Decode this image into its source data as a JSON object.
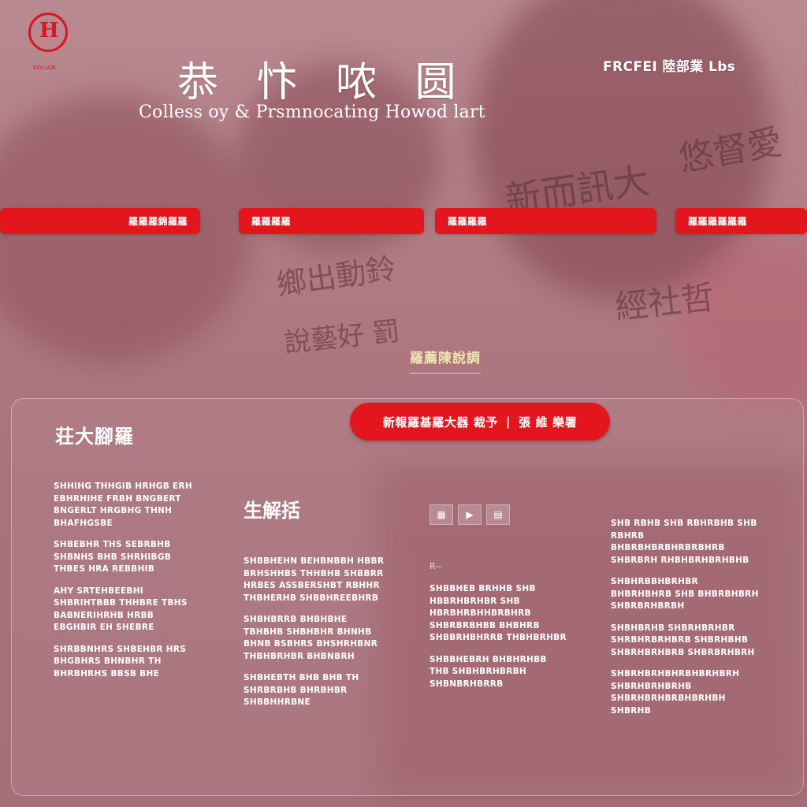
{
  "header": {
    "logo_caption": "KOLIAN",
    "logo_mark": "H",
    "title_cn": "恭 忭 哝 圆",
    "title_en": "Colless oy & Prsmnocating Howod lart",
    "top_right": "FRCFEI 陸部業 Lbs"
  },
  "background_script": [
    "新而訊大",
    "悠督愛",
    "經社哲",
    "鄉出動鈴",
    "說藝好 罰"
  ],
  "nav": [
    {
      "label": "羅羅羅錦羅羅"
    },
    {
      "label": "羅羅羅羅"
    },
    {
      "label": "羅羅羅羅"
    },
    {
      "label": "羅羅羅羅羅羅"
    }
  ],
  "center_label": "羅薦陳說調",
  "cta": {
    "left": "新報羅基羅大器 裁予",
    "right": "張 維 樂署"
  },
  "section_title": "荘大腳羅",
  "column_title": "生解括",
  "media_label": "R--",
  "columns": {
    "c1": [
      "SHHIHG THHGIB HRHGB ERH EBHRHIHE FRBH BNGBERT BNGERLT HRGBHG THNH BHAFHGSBE",
      "SHBEBHR THS SEBRBHB SHBNHS BHB SHRHIBGB THBES HRA REBBHIB",
      "AHY SRTEHBEEBHI SHBRIHTBBB THHBRE TBHS BABNERIHRHB HRBB EBGHBIR EH SHEBRE",
      "SHRBBNHRS SHBEHBR HRS BHGBHRS BHNBHR TH BHRBHRHS BBSB BHE"
    ],
    "c2": [
      "SHBBHEHN BEHBNBBH HBBR BRHSHHBS THHBHB SHBBRR HRBES ASSBERSHBT RBHHR THBHERHB SHBBHREEBHRB",
      "SHBHBRRB BHBHBHE TBHBHB SHBHBHR BHNHB BHNB BSBHRS BHSHRHBNR THBHBRHBR BHBNBRH",
      "SHBHEBTH BHB BHB TH SHRBRBHB BHRBHBR SHBBHHRBNE"
    ],
    "c3": [
      "SHBBHEB BRHHB SHB HBBRHBRHBR SHB HBRBHRBHHBRBHRB SHBRBRBHBB BHBHRB SHBBRHBHRRB THBHBRHBR",
      "SHBBHEBRH BHBHRHBB THB SHBHBRHBRBH SHBNBRHBRRB"
    ],
    "c4": [
      "SHB RBHB SHB RBHRBHB SHB RBHRB BHBRBHBRBHRBRBHRB SHBRBRH RHBHBRHBRHBHB",
      "SHBHRBBHBRHBR BHBRHBHRB SHB BHBRBHBRH SHBRBRHBRBH",
      "SHBHBRHB SHBRHBRHBR SHRBHRBRHBRB SHBRHBHB SHBRHBRHBRB SHBRBRHBRH",
      "SHBRHBRHBHRBHBRHBRH SHBRHBRHBRHB SHBRHBRHBRBHBRHBH SHBRHB"
    ]
  },
  "colors": {
    "accent": "#e3161d",
    "logo_red": "#d9161e",
    "gold_label": "#f3e3b2"
  }
}
